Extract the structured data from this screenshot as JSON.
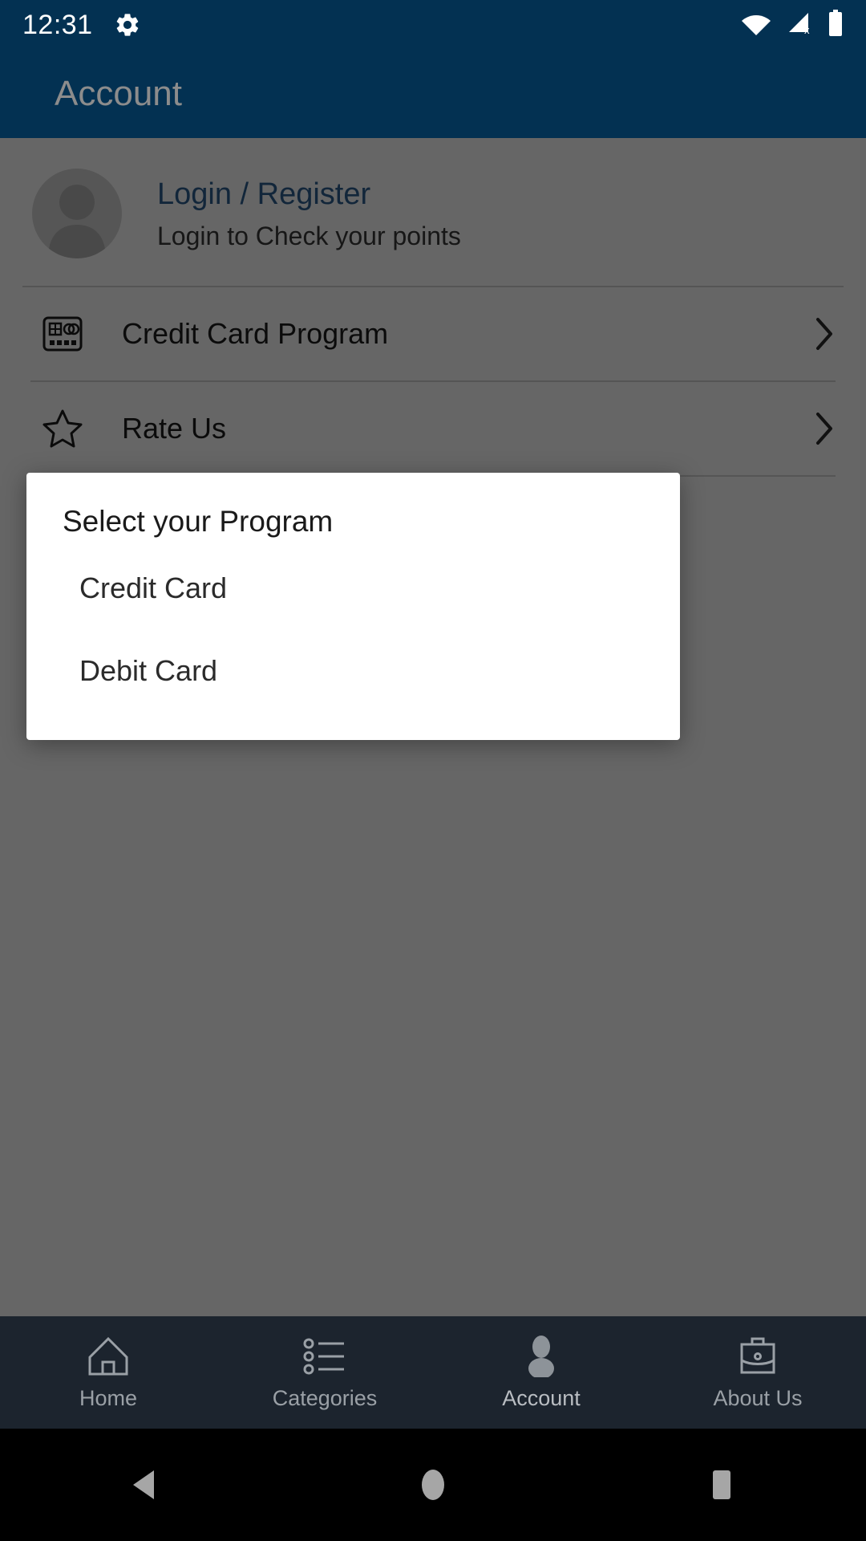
{
  "status_bar": {
    "time": "12:31",
    "icons": [
      "gear-icon",
      "wifi-icon",
      "cellular-no-sim-icon",
      "battery-icon"
    ]
  },
  "app_bar": {
    "title": "Account",
    "background_color": "#033152",
    "title_color": "#8c8c8c"
  },
  "account_page": {
    "profile": {
      "title": "Login / Register",
      "subtitle": "Login to Check your points",
      "title_color": "#2d5f92",
      "avatar_icon": "person-avatar-icon"
    },
    "rows": [
      {
        "label": "Credit Card Program",
        "icon": "credit-card-icon",
        "chevron": "chevron-right-icon"
      },
      {
        "label": "Rate Us",
        "icon": "star-outline-icon",
        "chevron": "chevron-right-icon"
      }
    ]
  },
  "dialog": {
    "title": "Select your Program",
    "options": [
      {
        "label": "Credit Card"
      },
      {
        "label": "Debit Card"
      }
    ],
    "background_color": "#ffffff"
  },
  "bottom_nav": {
    "items": [
      {
        "label": "Home",
        "icon": "home-icon",
        "active": false
      },
      {
        "label": "Categories",
        "icon": "list-bullet-icon",
        "active": false
      },
      {
        "label": "Account",
        "icon": "person-icon",
        "active": true
      },
      {
        "label": "About Us",
        "icon": "briefcase-icon",
        "active": false
      }
    ],
    "background_color": "#1c242e"
  },
  "system_nav": {
    "buttons": [
      "back-triangle-icon",
      "home-circle-icon",
      "recents-square-icon"
    ]
  }
}
